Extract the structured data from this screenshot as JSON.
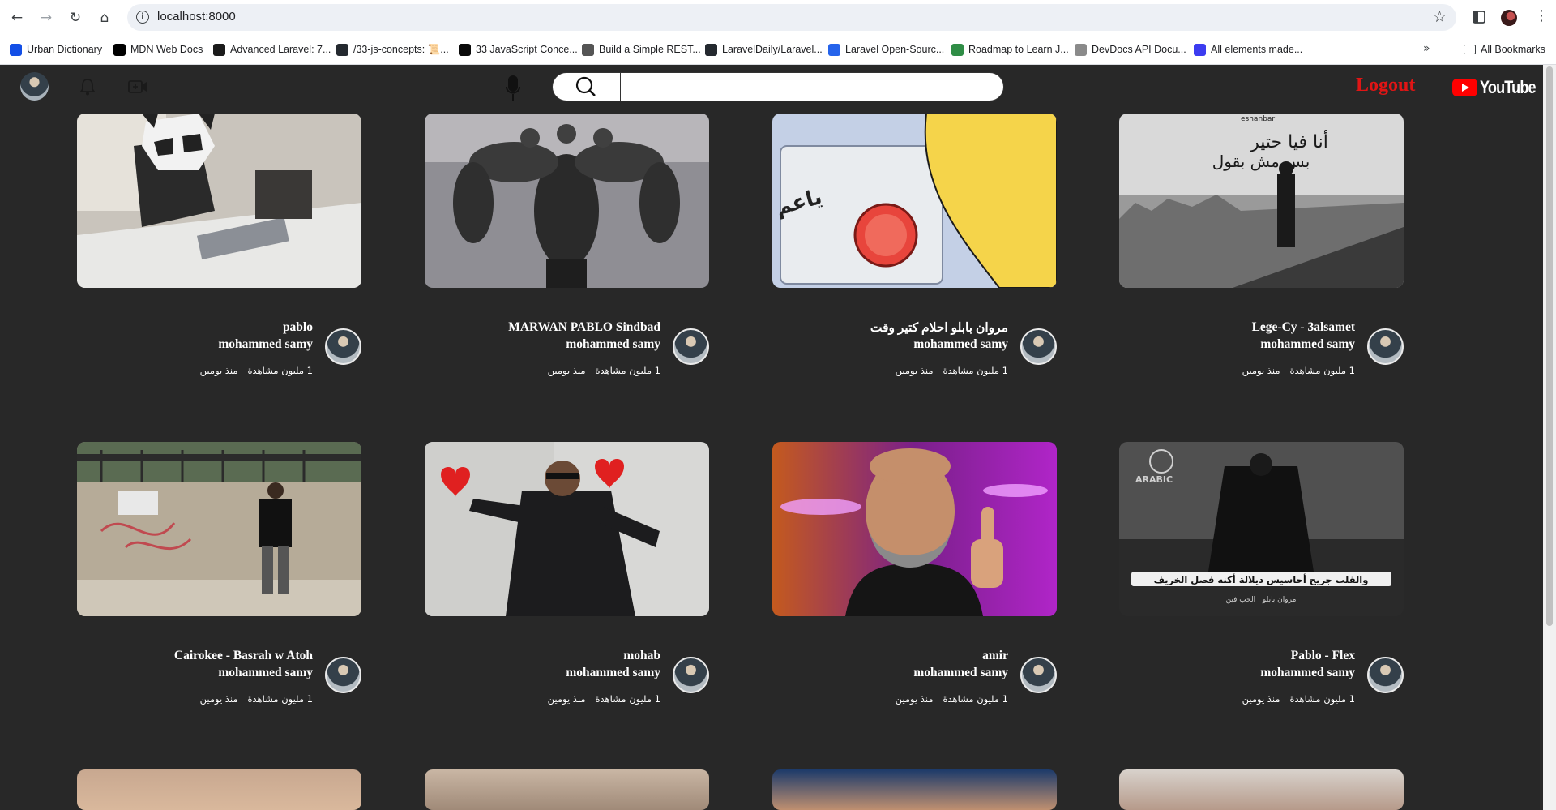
{
  "browser": {
    "url": "localhost:8000",
    "bookmarks": [
      {
        "label": "Urban Dictionary",
        "color": "#134fe6"
      },
      {
        "label": "MDN Web Docs",
        "color": "#000000"
      },
      {
        "label": "Advanced Laravel: 7...",
        "color": "#1b1b1b"
      },
      {
        "label": "/33-js-concepts: 📜...",
        "color": "#24292f"
      },
      {
        "label": "33 JavaScript Conce...",
        "color": "#0a0a0a"
      },
      {
        "label": "Build a Simple REST...",
        "color": "#555555"
      },
      {
        "label": "LaravelDaily/Laravel...",
        "color": "#24292f"
      },
      {
        "label": "Laravel Open-Sourc...",
        "color": "#2563eb"
      },
      {
        "label": "Roadmap to Learn J...",
        "color": "#2f8d46"
      },
      {
        "label": "DevDocs API Docu...",
        "color": "#8a8a8a"
      },
      {
        "label": "All elements made...",
        "color": "#3c3cf0"
      }
    ],
    "all_bookmarks_label": "All Bookmarks"
  },
  "header": {
    "logout_label": "Logout",
    "logo_text": "YouTube",
    "search_placeholder": ""
  },
  "videos": [
    {
      "title": "pablo",
      "channel": "mohammed samy",
      "views": "1 مليون مشاهدة",
      "age": "منذ يومين",
      "thumb": "panda"
    },
    {
      "title": "MARWAN PABLO Sindbad",
      "channel": "mohammed samy",
      "views": "1 مليون مشاهدة",
      "age": "منذ يومين",
      "thumb": "muscle"
    },
    {
      "title": "مروان بابلو احلام كتير وقت",
      "channel": "mohammed samy",
      "views": "1 مليون مشاهدة",
      "age": "منذ يومين",
      "thumb": "button"
    },
    {
      "title": "Lege-Cy - 3alsamet",
      "channel": "mohammed samy",
      "views": "1 مليون مشاهدة",
      "age": "منذ يومين",
      "thumb": "roof"
    },
    {
      "title": "Cairokee - Basrah w Atoh",
      "channel": "mohammed samy",
      "views": "1 مليون مشاهدة",
      "age": "منذ يومين",
      "thumb": "wall"
    },
    {
      "title": "mohab",
      "channel": "mohammed samy",
      "views": "1 مليون مشاهدة",
      "age": "منذ يومين",
      "thumb": "hearts"
    },
    {
      "title": "amir",
      "channel": "mohammed samy",
      "views": "1 مليون مشاهدة",
      "age": "منذ يومين",
      "thumb": "thumbsup"
    },
    {
      "title": "Pablo - Flex",
      "channel": "mohammed samy",
      "views": "1 مليون مشاهدة",
      "age": "منذ يومين",
      "thumb": "arabic"
    }
  ],
  "thumb_text": {
    "button_text": "ياعم علي الله",
    "roof_line1": "أنا فيا حتير",
    "roof_line2": "بس مش بقول",
    "roof_small": "eshanbar",
    "arabic_logo": "ARABIC",
    "arabic_caption": "والقلب جريح أحاسيس ديلالة أكنه فصل الخريف",
    "arabic_credit": "مروان بابلو : الحب فين"
  }
}
